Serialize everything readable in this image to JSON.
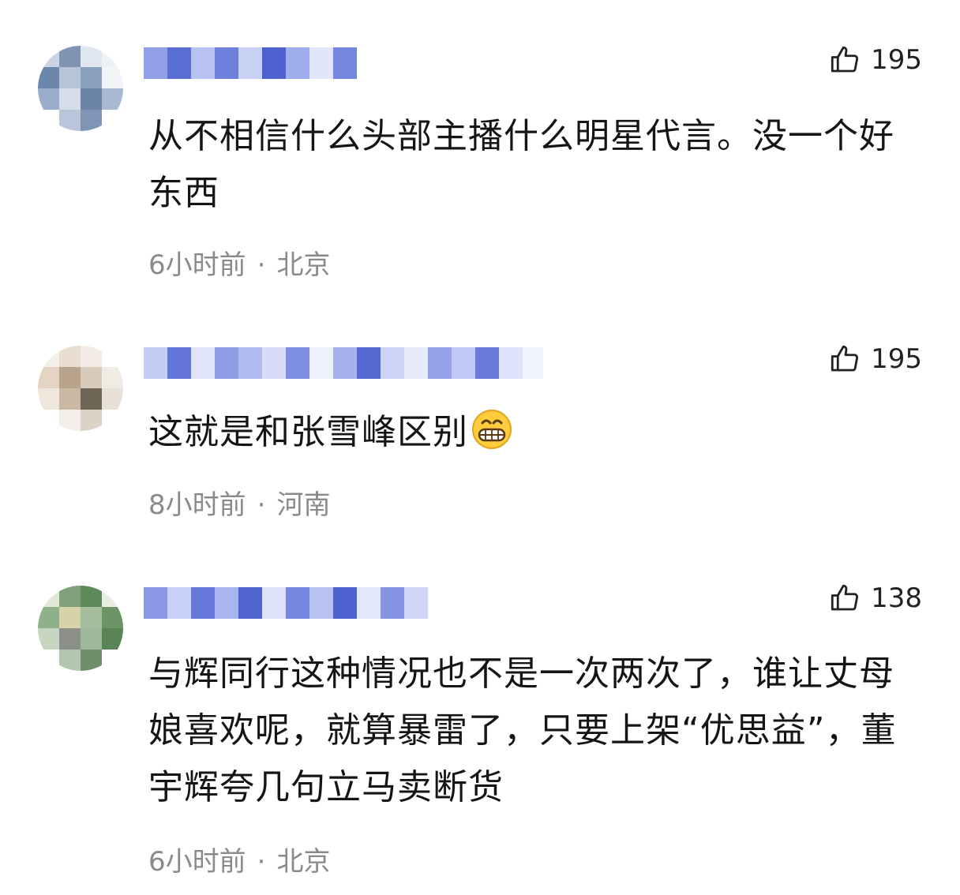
{
  "comments": [
    {
      "likes": "195",
      "text": "从不相信什么头部主播什么明星代言。没一个好东西",
      "time": "6小时前",
      "separator": "·",
      "location": "北京"
    },
    {
      "likes": "195",
      "text": "这就是和张雪峰区别",
      "emoji": "grinning-face-emoji",
      "time": "8小时前",
      "separator": "·",
      "location": "河南"
    },
    {
      "likes": "138",
      "text": "与辉同行这种情况也不是一次两次了，谁让丈母娘喜欢呢，就算暴雷了，只要上架“优思益”，董宇辉夸几句立马卖断货",
      "time": "6小时前",
      "separator": "·",
      "location": "北京"
    }
  ],
  "icons": {
    "like": "thumbs-up-icon"
  },
  "colors": {
    "meta": "#8a8a8a",
    "username_blur": "#4a5fd0"
  }
}
